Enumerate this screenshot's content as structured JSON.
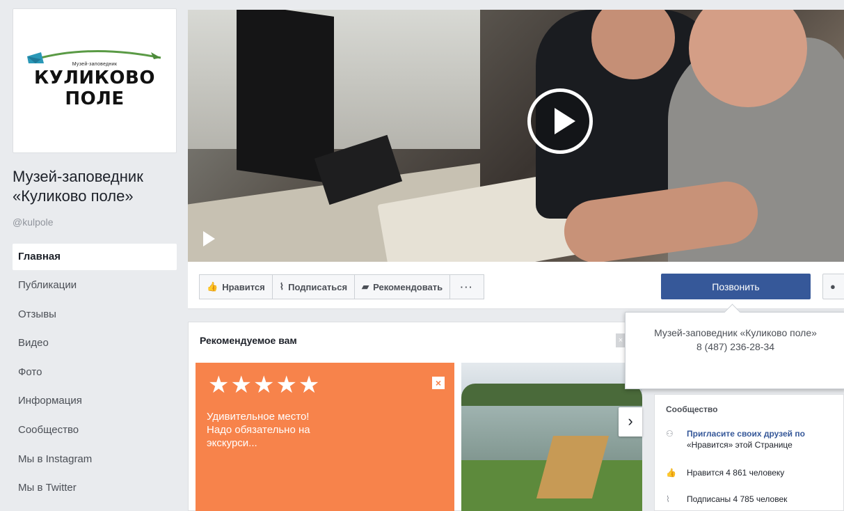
{
  "logo": {
    "small_text": "Музей-заповедник",
    "big_line1": "КУЛИКОВО",
    "big_line2": "ПОЛЕ"
  },
  "page": {
    "name": "Музей-заповедник «Куликово поле»",
    "handle": "@kulpole"
  },
  "nav": [
    {
      "label": "Главная",
      "active": true
    },
    {
      "label": "Публикации"
    },
    {
      "label": "Отзывы"
    },
    {
      "label": "Видео"
    },
    {
      "label": "Фото"
    },
    {
      "label": "Информация"
    },
    {
      "label": "Сообщество"
    },
    {
      "label": "Мы в Instagram"
    },
    {
      "label": "Мы в Twitter"
    }
  ],
  "actions": {
    "like": "Нравится",
    "follow": "Подписаться",
    "recommend": "Рекомендовать",
    "more": "···",
    "call": "Позвонить"
  },
  "tooltip": {
    "line1": "Музей-заповедник «Куликово поле»",
    "phone": "8 (487) 236-28-34"
  },
  "recommended": {
    "title": "Рекомендуемое вам",
    "stars": "★★★★★",
    "review_text": "Удивительное место! Надо обязательно на экскурси..."
  },
  "community": {
    "title": "Сообщество",
    "invite_link": "Пригласите своих друзей по",
    "invite_rest": "«Нравится» этой Странице",
    "likes": "Нравится 4 861 человеку",
    "subscribers": "Подписаны 4 785 человек"
  },
  "colors": {
    "call_button": "#365899",
    "review_card": "#f7834b",
    "background": "#e9ebee"
  },
  "icons": [
    "like-icon",
    "rss-icon",
    "recommend-icon",
    "play-icon",
    "close-icon",
    "chevron-right-icon",
    "messenger-icon",
    "invite-icon"
  ]
}
